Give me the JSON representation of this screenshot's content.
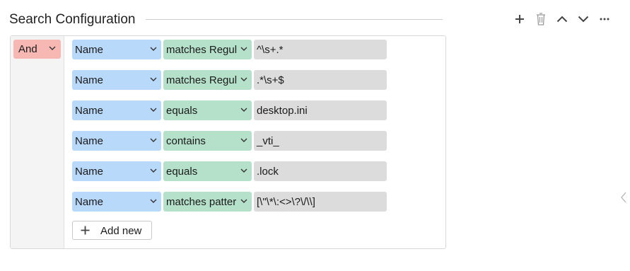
{
  "section": {
    "title": "Search Configuration"
  },
  "toolbar": {
    "add_icon": "plus-icon",
    "delete_icon": "trash-icon",
    "up_icon": "chevron-up-icon",
    "down_icon": "chevron-down-icon",
    "more_icon": "more-horizontal-icon"
  },
  "logic": {
    "operator": "And",
    "color": "#f7b8b4"
  },
  "rows": [
    {
      "field": "Name",
      "operator": "matches Regular Expression",
      "value": "^\\s+.*"
    },
    {
      "field": "Name",
      "operator": "matches Regular Expression",
      "value": ".*\\s+$"
    },
    {
      "field": "Name",
      "operator": "equals",
      "value": "desktop.ini"
    },
    {
      "field": "Name",
      "operator": "contains",
      "value": "_vti_"
    },
    {
      "field": "Name",
      "operator": "equals",
      "value": ".lock"
    },
    {
      "field": "Name",
      "operator": "matches pattern",
      "value": "[\\\"\\*\\:<>\\?\\/\\\\]"
    }
  ],
  "add_button": {
    "label": "Add new"
  },
  "colors": {
    "field": "#b9d9fb",
    "operator": "#b5e1cb",
    "value": "#dcdcdc"
  }
}
